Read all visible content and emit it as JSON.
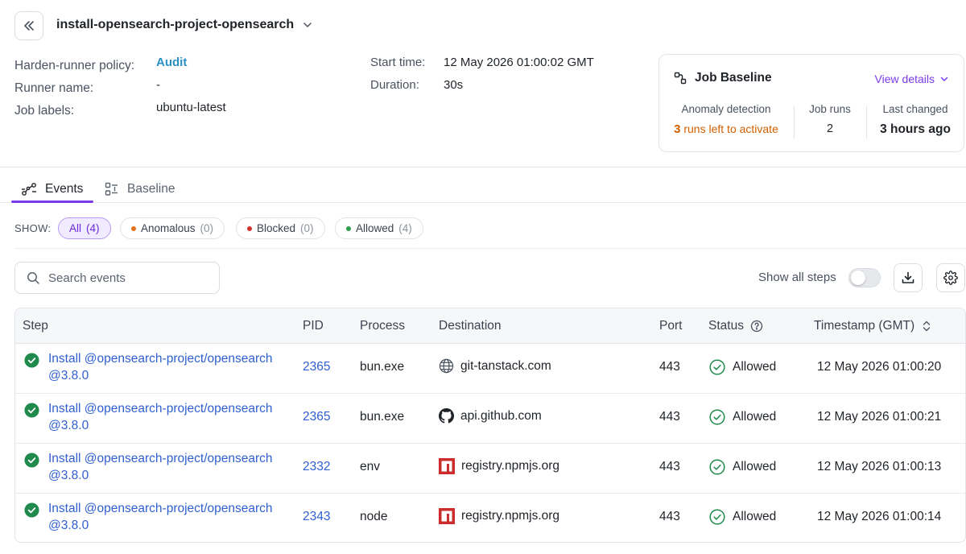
{
  "header": {
    "job_name": "install-opensearch-project-opensearch"
  },
  "meta": {
    "policy_label": "Harden-runner policy:",
    "policy_value": "Audit",
    "runner_label": "Runner name:",
    "runner_value": "-",
    "labels_label": "Job labels:",
    "labels_value": "ubuntu-latest",
    "start_label": "Start time:",
    "start_value": "12 May 2026 01:00:02 GMT",
    "duration_label": "Duration:",
    "duration_value": "30s"
  },
  "baseline": {
    "title": "Job Baseline",
    "view_details": "View details",
    "anomaly_label": "Anomaly detection",
    "runs_left_count": "3",
    "runs_left_text": "runs left to activate",
    "job_runs_label": "Job runs",
    "job_runs_value": "2",
    "last_changed_label": "Last changed",
    "last_changed_value": "3 hours ago"
  },
  "tabs": {
    "events": "Events",
    "baseline": "Baseline"
  },
  "filters": {
    "show_label": "SHOW:",
    "all": "All",
    "all_count": "(4)",
    "anomalous": "Anomalous",
    "anomalous_count": "(0)",
    "blocked": "Blocked",
    "blocked_count": "(0)",
    "allowed": "Allowed",
    "allowed_count": "(4)"
  },
  "colors": {
    "accent": "#7c3aed",
    "anomalous_dot": "#e0711b",
    "blocked_dot": "#d32f2f",
    "allowed_dot": "#2e9d4a",
    "success": "#1f8a4c",
    "link": "#2f5fd0"
  },
  "toolbar": {
    "search_placeholder": "Search events",
    "show_all_steps": "Show all steps"
  },
  "table": {
    "columns": {
      "step": "Step",
      "pid": "PID",
      "process": "Process",
      "destination": "Destination",
      "port": "Port",
      "status": "Status",
      "timestamp": "Timestamp (GMT)"
    },
    "rows": [
      {
        "step_line1": "Install @opensearch-project/opensearch",
        "step_line2": "@3.8.0",
        "pid": "2365",
        "process": "bun.exe",
        "destination": "git-tanstack.com",
        "dest_icon": "globe-icon",
        "port": "443",
        "status": "Allowed",
        "timestamp": "12 May 2026 01:00:20"
      },
      {
        "step_line1": "Install @opensearch-project/opensearch",
        "step_line2": "@3.8.0",
        "pid": "2365",
        "process": "bun.exe",
        "destination": "api.github.com",
        "dest_icon": "github-icon",
        "port": "443",
        "status": "Allowed",
        "timestamp": "12 May 2026 01:00:21"
      },
      {
        "step_line1": "Install @opensearch-project/opensearch",
        "step_line2": "@3.8.0",
        "pid": "2332",
        "process": "env",
        "destination": "registry.npmjs.org",
        "dest_icon": "npm-icon",
        "port": "443",
        "status": "Allowed",
        "timestamp": "12 May 2026 01:00:13"
      },
      {
        "step_line1": "Install @opensearch-project/opensearch",
        "step_line2": "@3.8.0",
        "pid": "2343",
        "process": "node",
        "destination": "registry.npmjs.org",
        "dest_icon": "npm-icon",
        "port": "443",
        "status": "Allowed",
        "timestamp": "12 May 2026 01:00:14"
      }
    ]
  }
}
